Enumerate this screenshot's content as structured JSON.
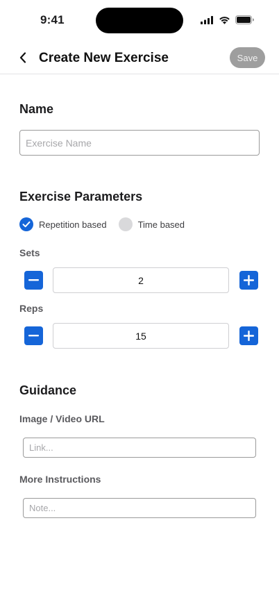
{
  "status_bar": {
    "time": "9:41"
  },
  "nav": {
    "title": "Create New Exercise",
    "save_label": "Save"
  },
  "name_section": {
    "title": "Name",
    "placeholder": "Exercise Name",
    "value": ""
  },
  "parameters": {
    "title": "Exercise Parameters",
    "options": [
      {
        "label": "Repetition based",
        "selected": true
      },
      {
        "label": "Time based",
        "selected": false
      }
    ],
    "sets": {
      "label": "Sets",
      "value": "2"
    },
    "reps": {
      "label": "Reps",
      "value": "15"
    }
  },
  "guidance": {
    "title": "Guidance",
    "url_label": "Image / Video URL",
    "url_placeholder": "Link...",
    "instructions_label": "More Instructions",
    "instructions_placeholder": "Note..."
  },
  "colors": {
    "accent": "#1565d8",
    "save_disabled": "#9e9e9e",
    "unselected": "#d9d9db"
  },
  "icons": [
    "back-chevron-icon",
    "signal-icon",
    "wifi-icon",
    "battery-icon",
    "check-icon",
    "minus-icon",
    "plus-icon"
  ]
}
